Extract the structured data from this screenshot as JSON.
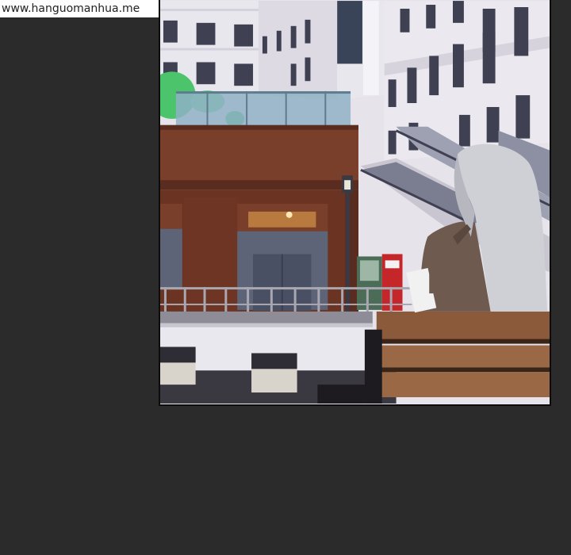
{
  "watermark": {
    "text": "www.hanguomanhua.me"
  },
  "page": {
    "background_color": "#2b2b2b"
  },
  "panel": {
    "scene_colors": {
      "building_light": "#e9e7ee",
      "building_shadow": "#c9c6d2",
      "window": "#3f4152",
      "wood": "#7a3f2a",
      "wood_dark": "#5a2c1f",
      "glass": "#8fb2c6",
      "foliage": "#4bc46b",
      "hair": "#cfcfd6",
      "coat": "#6e5a4f",
      "bench": "#8a5a3a",
      "vending_red": "#c4262a"
    }
  }
}
